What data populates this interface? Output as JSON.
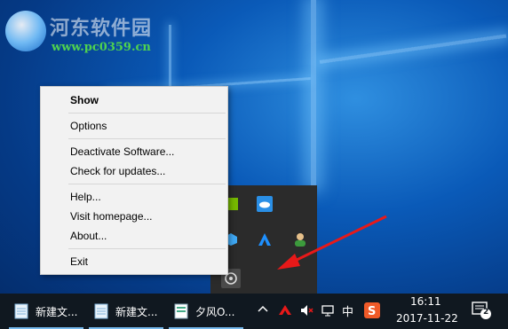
{
  "watermark": {
    "site_name": "河东软件园",
    "url": "www.pc0359.cn"
  },
  "context_menu": {
    "items": [
      {
        "label": "Show",
        "bold": true
      },
      {
        "label": "Options"
      },
      {
        "label": "Deactivate Software..."
      },
      {
        "label": "Check for updates..."
      },
      {
        "label": "Help..."
      },
      {
        "label": "Visit homepage..."
      },
      {
        "label": "About..."
      },
      {
        "label": "Exit"
      }
    ]
  },
  "taskbar": {
    "apps": [
      {
        "label": "新建文...",
        "icon": "notepad-icon"
      },
      {
        "label": "新建文...",
        "icon": "notepad-icon"
      },
      {
        "label": "夕风O...",
        "icon": "document-icon"
      }
    ],
    "ime_label": "中",
    "clock_time": "16:11",
    "clock_date": "2017-11-22",
    "notification_count": "2"
  },
  "colors": {
    "arrow": "#e81919",
    "menu_bg": "#f2f2f2",
    "taskbar_bg": "#101820"
  }
}
